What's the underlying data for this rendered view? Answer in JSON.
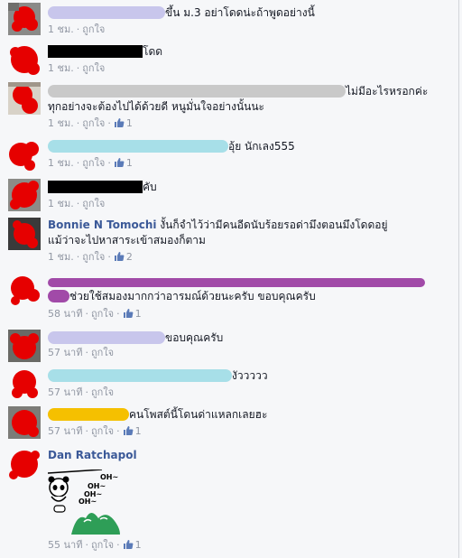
{
  "comments": [
    {
      "text": "ขึ้น ม.3 อย่าโดดน่ะถ้าพูดอย่างนี้",
      "time": "1 ชม.",
      "like": "ถูกใจ",
      "likes": ""
    },
    {
      "text": "โดด",
      "time": "1 ชม.",
      "like": "ถูกใจ",
      "likes": ""
    },
    {
      "text": "ไม่มีอะไรหรอกค่ะ",
      "text2": "ทุกอย่างจะต้องไปได้ด้วยดี หนูมั่นใจอย่างนั้นนะ",
      "time": "1 ชม.",
      "like": "ถูกใจ",
      "likes": "1"
    },
    {
      "text": "อุ้ย นักเลง555",
      "time": "1 ชม.",
      "like": "ถูกใจ",
      "likes": "1"
    },
    {
      "text": "คับ",
      "time": "1 ชม.",
      "like": "ถูกใจ",
      "likes": ""
    },
    {
      "author": "Bonnie N Tomochi",
      "text": "งั้นก็จำไว้ว่ามีคนอีดนับร้อยรอด่ามึงตอนมึงโดดอยู่",
      "text2": "แม้ว่าจะไปหาสาระเข้าสมองก็ตาม",
      "time": "1 ชม.",
      "like": "ถูกใจ",
      "likes": "2"
    },
    {
      "text2": "ช่วยใช้สมองมากกว่าอารมณ์ด้วยนะครับ ขอบคุณครับ",
      "time": "58 นาที",
      "like": "ถูกใจ",
      "likes": "1"
    },
    {
      "text": "ขอบคุณครับ",
      "time": "57 นาที",
      "like": "ถูกใจ",
      "likes": ""
    },
    {
      "text": "งัววววว",
      "time": "57 นาที",
      "like": "ถูกใจ",
      "likes": ""
    },
    {
      "text": "คนโพสต์นี้โดนด่าแหลกเลยฮะ",
      "time": "57 นาที",
      "like": "ถูกใจ",
      "likes": "1"
    },
    {
      "author": "Dan Ratchapol",
      "time": "55 นาที",
      "like": "ถูกใจ",
      "likes": "1",
      "sticker_text": [
        "OH~",
        "OH~",
        "OH~",
        "OH~"
      ]
    }
  ],
  "colors": {
    "link": "#3b5998",
    "meta": "#9197a3",
    "redact_lavender": "#c8c6ec",
    "redact_black": "#000000",
    "redact_gray": "#c9c9c9",
    "redact_cyan": "#a7dfe8",
    "redact_purple": "#a14aa8",
    "redact_yellow": "#f5c000",
    "avatar_red": "#e60000"
  }
}
